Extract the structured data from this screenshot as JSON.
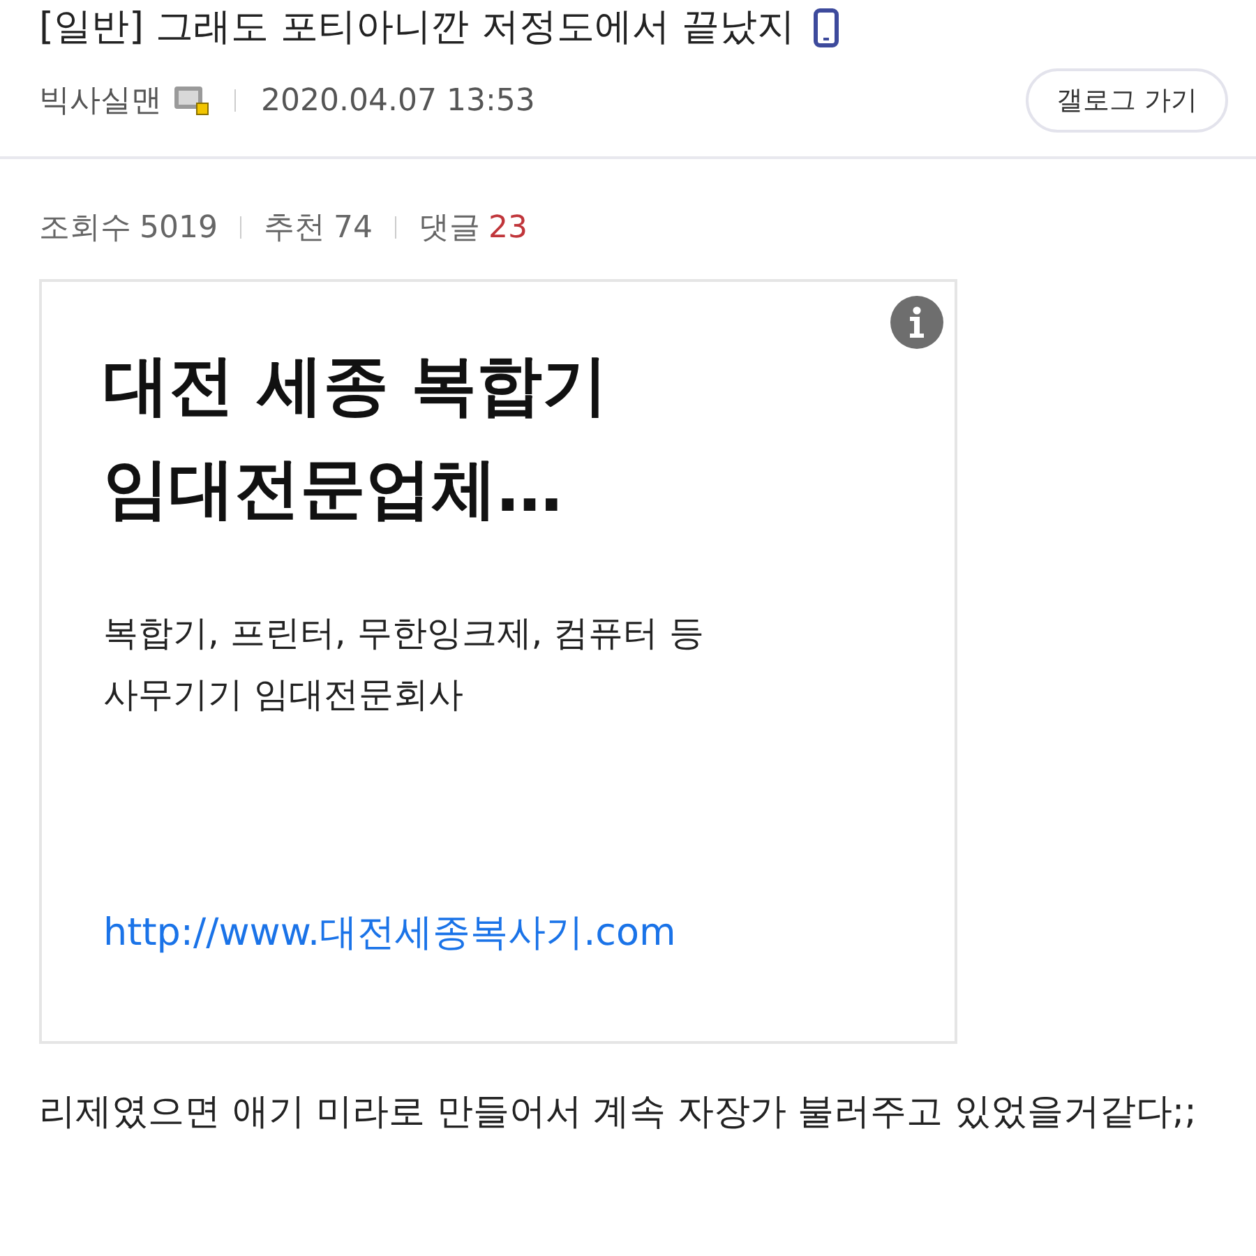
{
  "post": {
    "title": "[일반] 그래도 포티아니깐 저정도에서 끝났지",
    "author": "빅사실맨",
    "date": "2020.04.07 13:53",
    "gallery_button": "갤로그 가기"
  },
  "stats": [
    {
      "label": "조회수",
      "value": "5019",
      "kind": "plain"
    },
    {
      "label": "추천",
      "value": "74",
      "kind": "plain"
    },
    {
      "label": "댓글",
      "value": "23",
      "kind": "highlight"
    }
  ],
  "ad": {
    "headline": [
      "대전 세종 복합기",
      "임대전문업체…"
    ],
    "description": [
      "복합기, 프린터, 무한잉크제, 컴퓨터 등",
      "사무기기 임대전문회사"
    ],
    "url": "http://www.대전세종복사기.com"
  },
  "body": "리제였으면 애기 미라로 만들어서 계속 자장가 불러주고 있었을거같다;;"
}
